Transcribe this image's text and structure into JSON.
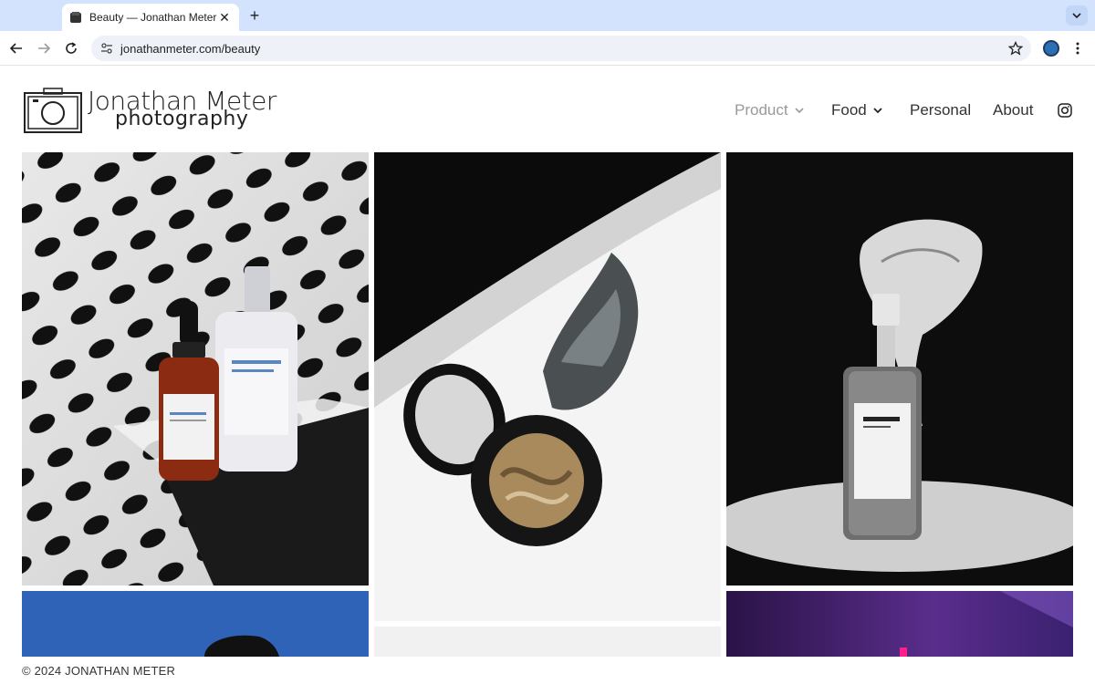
{
  "browser": {
    "tab_title": "Beauty — Jonathan Meter Pho",
    "url": "jonathanmeter.com/beauty",
    "accent": "#d3e3fd"
  },
  "site": {
    "logo_name": "Jonathan Meter",
    "logo_sub": "photography",
    "nav": [
      {
        "label": "Product",
        "dropdown": true,
        "active": true
      },
      {
        "label": "Food",
        "dropdown": true
      },
      {
        "label": "Personal"
      },
      {
        "label": "About"
      }
    ],
    "instagram_icon": "instagram-icon"
  },
  "gallery": {
    "items": [
      {
        "name": "serum-bottles-photo",
        "subject": "skincare bottles on dotted backdrop"
      },
      {
        "name": "eyeshadow-compact-photo",
        "subject": "eyeshadow compact with swatch"
      },
      {
        "name": "mist-bottle-flower-photo",
        "subject": "spray bottle with calla lily"
      },
      {
        "name": "blue-backdrop-photo",
        "subject": "partial photo on blue"
      },
      {
        "name": "grey-backdrop-photo",
        "subject": "partial photo"
      },
      {
        "name": "purple-backdrop-photo",
        "subject": "partial photo on purple"
      }
    ]
  },
  "footer": {
    "copyright": "© 2024 JONATHAN METER"
  }
}
